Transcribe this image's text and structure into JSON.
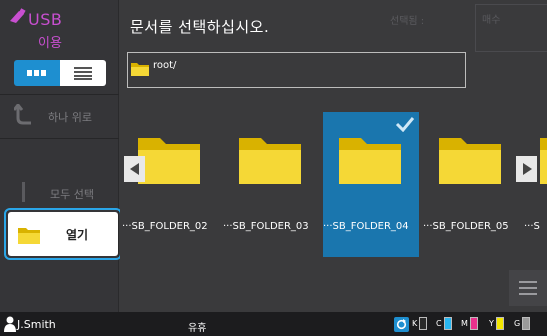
{
  "sidebar": {
    "app_title": "USB",
    "app_subtitle": "이용",
    "view_grid_label": "grid-view",
    "view_list_label": "list-view",
    "up_label": "하나 위로",
    "select_all_label": "모두 선택",
    "open_label": "열기"
  },
  "header": {
    "title": "문서를 선택하십시오.",
    "selected_label": "선택됨 :",
    "pages_label": "매수"
  },
  "path": {
    "value": "root/"
  },
  "folders": [
    {
      "name": "···SB_FOLDER_02",
      "selected": false
    },
    {
      "name": "···SB_FOLDER_03",
      "selected": false
    },
    {
      "name": "···SB_FOLDER_04",
      "selected": true
    },
    {
      "name": "···SB_FOLDER_05",
      "selected": false
    },
    {
      "name": "···S",
      "selected": false
    }
  ],
  "status": {
    "user": "J.Smith",
    "state": "유휴",
    "toners": [
      {
        "label": "K",
        "color": "#ffffff",
        "fill": "#2a2a2a"
      },
      {
        "label": "C",
        "color": "#ffffff",
        "fill": "#29b6f0"
      },
      {
        "label": "M",
        "color": "#ffffff",
        "fill": "#e8318c"
      },
      {
        "label": "Y",
        "color": "#ffffff",
        "fill": "#f2e600"
      },
      {
        "label": "G",
        "color": "#ffffff",
        "fill": "#9a9a9a"
      }
    ]
  },
  "colors": {
    "accent": "#1e8fd0",
    "usb_purple": "#c84fd0",
    "selection": "#1a76ae",
    "folder_yellow": "#f5d836"
  }
}
